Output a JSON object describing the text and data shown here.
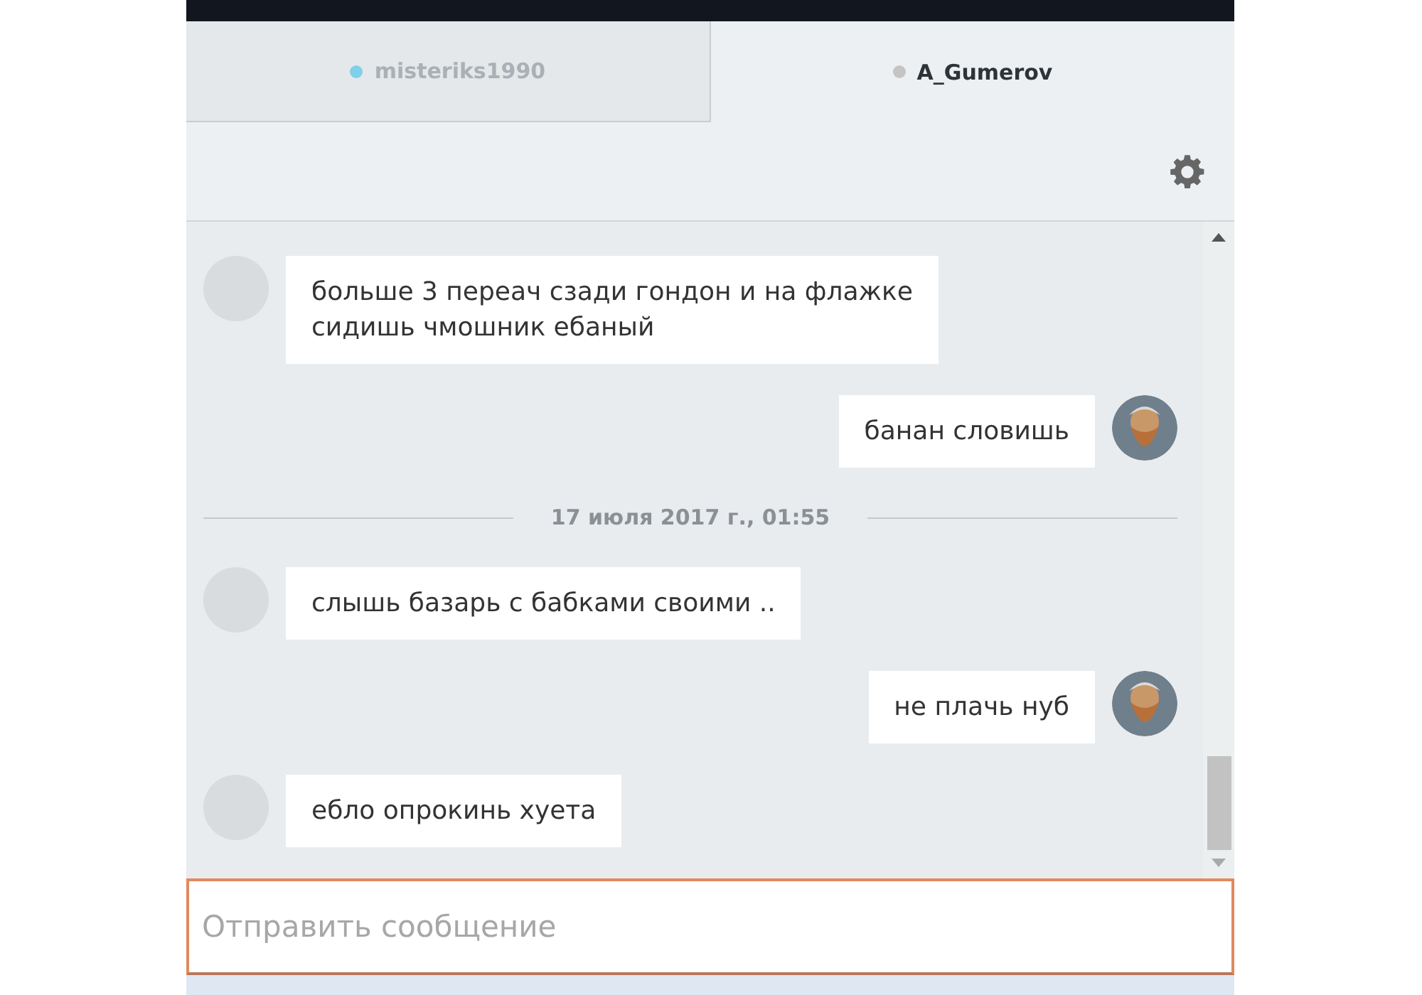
{
  "tabs": [
    {
      "label": "misteriks1990",
      "selected": false,
      "color": "#7fd0ea"
    },
    {
      "label": "A_Gumerov",
      "selected": true,
      "color": "#c4c4c4"
    }
  ],
  "messages": [
    {
      "kind": "in",
      "lines": [
        "больше 3 переач сзади гондон и на флажке",
        "сидишь чмошник ебаный"
      ]
    },
    {
      "kind": "out",
      "lines": [
        "банан словишь"
      ]
    },
    {
      "kind": "date",
      "lines": [
        "17 июля 2017 г., 01:55"
      ]
    },
    {
      "kind": "in",
      "lines": [
        "слышь базарь с бабками своими .."
      ]
    },
    {
      "kind": "out",
      "lines": [
        "не плачь нуб"
      ]
    },
    {
      "kind": "in",
      "lines": [
        "ебло опрокинь хуета"
      ]
    }
  ],
  "composer": {
    "placeholder": "Отправить сообщение"
  }
}
